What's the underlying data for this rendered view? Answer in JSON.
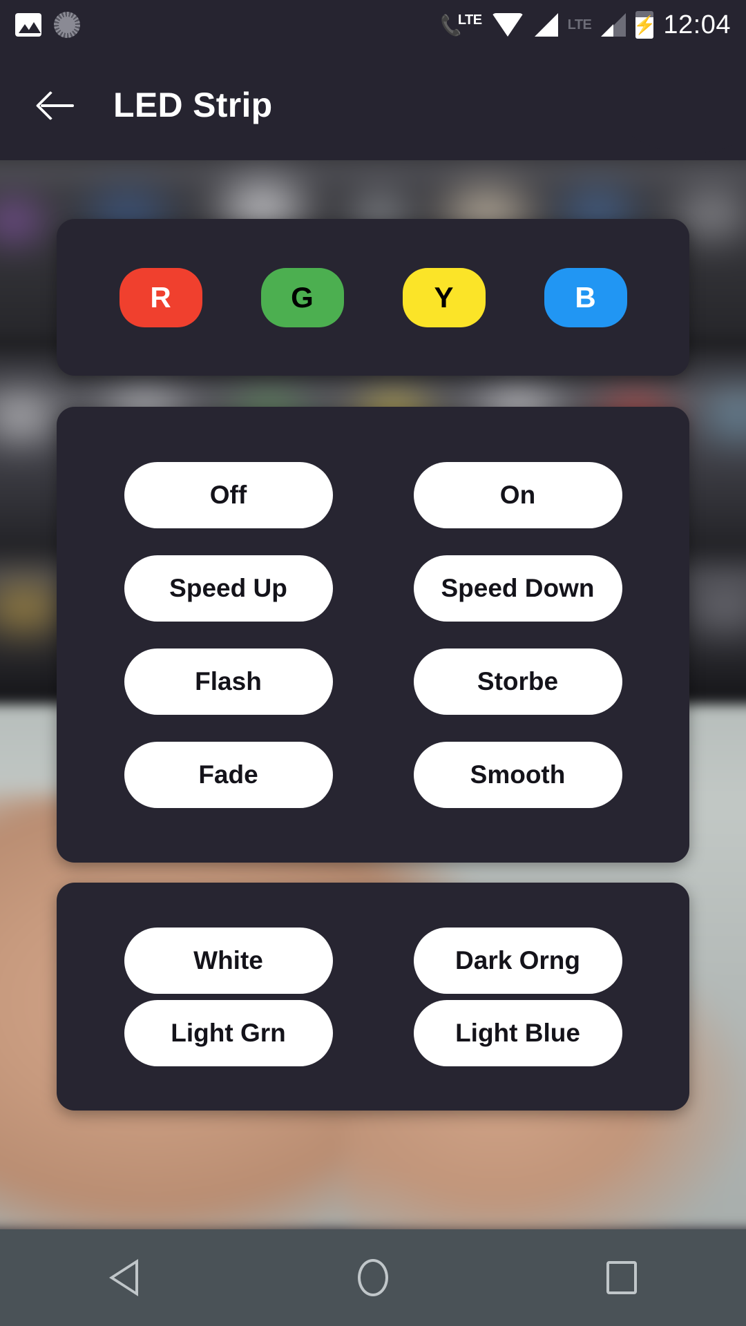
{
  "status_bar": {
    "left_icons": [
      {
        "name": "image-icon",
        "glyph": "image"
      },
      {
        "name": "sync-spinner-icon",
        "glyph": "spinner"
      }
    ],
    "volte_label": "LTE",
    "lte_label": "LTE",
    "time": "12:04",
    "battery_charging": true,
    "background_color": "#262430"
  },
  "app_bar": {
    "back_label": "Back",
    "title": "LED Strip",
    "background_color": "#262430"
  },
  "color_panel": {
    "name": "color-shortcuts",
    "buttons": [
      {
        "label": "R",
        "name": "red",
        "bg": "#F0402E",
        "fg": "#FFFFFF"
      },
      {
        "label": "G",
        "name": "green",
        "bg": "#4CAF50",
        "fg": "#000000"
      },
      {
        "label": "Y",
        "name": "yellow",
        "bg": "#FBE428",
        "fg": "#000000"
      },
      {
        "label": "B",
        "name": "blue",
        "bg": "#2196F3",
        "fg": "#FFFFFF"
      }
    ]
  },
  "mode_panel": {
    "name": "mode-controls",
    "buttons": [
      {
        "label": "Off",
        "name": "off"
      },
      {
        "label": "On",
        "name": "on"
      },
      {
        "label": "Speed Up",
        "name": "speed-up"
      },
      {
        "label": "Speed Down",
        "name": "speed-down"
      },
      {
        "label": "Flash",
        "name": "flash"
      },
      {
        "label": "Storbe",
        "name": "storbe"
      },
      {
        "label": "Fade",
        "name": "fade"
      },
      {
        "label": "Smooth",
        "name": "smooth"
      }
    ]
  },
  "preset_panel": {
    "name": "color-presets",
    "buttons": [
      {
        "label": "White",
        "name": "white"
      },
      {
        "label": "Dark Orng",
        "name": "dark-orange"
      },
      {
        "label": "Light Grn",
        "name": "light-green"
      },
      {
        "label": "Light Blue",
        "name": "light-blue"
      }
    ]
  },
  "nav_bar": {
    "back": "Back",
    "home": "Home",
    "recents": "Recents",
    "background_color": "#4A5257"
  },
  "theme": {
    "panel_bg": "#272531",
    "button_bg": "#FFFFFF",
    "button_fg": "#14131A",
    "app_bar_bg": "#262430"
  }
}
